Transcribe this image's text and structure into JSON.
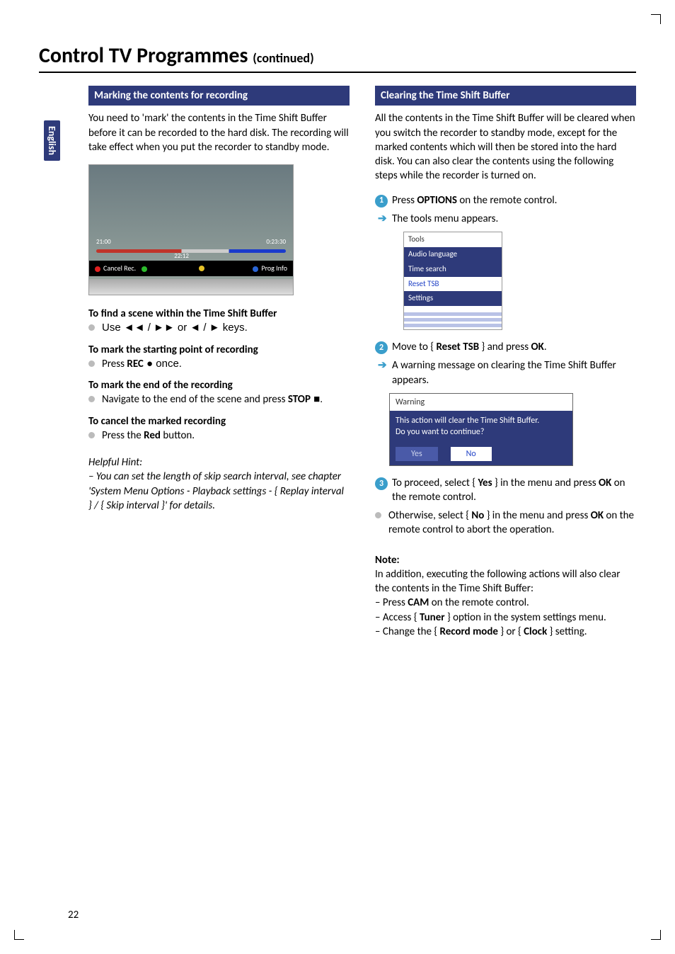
{
  "sideTab": "English",
  "title_main": "Control TV Programmes ",
  "title_cont": "(continued)",
  "left": {
    "header": "Marking the contents for recording",
    "intro": "You need to 'mark' the contents in the Time Shift Buffer before it can be recorded to the hard disk. The recording will take effect when you put the recorder to standby mode.",
    "screenshot": {
      "time_left": "21:00",
      "time_right": "0:23:30",
      "time_center": "22:12",
      "bar_left": "Cancel Rec.",
      "bar_right": "Prog Info"
    },
    "find_head": "To find a scene within the Time Shift Buffer",
    "find_body": "Use ◄◄ / ►► or ◄ / ► keys.",
    "start_head": "To mark the starting point of recording",
    "start_body_pre": "Press ",
    "start_body_btn": "REC",
    "start_body_post": " ● once.",
    "end_head": "To mark the end of the recording",
    "end_body_pre": "Navigate to the end of the scene and press ",
    "end_body_btn": "STOP",
    "end_body_post": " ■.",
    "cancel_head": "To cancel the marked recording",
    "cancel_body_pre": "Press the ",
    "cancel_body_btn": "Red",
    "cancel_body_post": " button.",
    "hint_label": "Helpful Hint:",
    "hint_body": "–  You can set the length of skip search interval, see chapter 'System Menu Options - Playback settings - { Replay interval } / { Skip interval }' for details."
  },
  "right": {
    "header": "Clearing the Time Shift Buffer",
    "intro": "All the contents in the Time Shift Buffer will be cleared when you switch the recorder to standby mode, except for the marked contents which will then be stored into the hard disk. You can also clear the contents using the following steps while the recorder is turned on.",
    "step1_pre": "Press ",
    "step1_btn": "OPTIONS",
    "step1_post": " on the remote control.",
    "step1_arrow": "The tools menu appears.",
    "tools": {
      "title": "Tools",
      "items": [
        "Audio language",
        "Time search",
        "Reset TSB",
        "Settings"
      ]
    },
    "step2_pre": "Move to { ",
    "step2_opt": "Reset TSB",
    "step2_mid": " } and press ",
    "step2_btn": "OK",
    "step2_post": ".",
    "step2_arrow": "A warning message on clearing the Time Shift Buffer appears.",
    "warn": {
      "title": "Warning",
      "line1": "This action will clear the Time Shift Buffer.",
      "line2": "Do you want to continue?",
      "yes": "Yes",
      "no": "No"
    },
    "step3_pre": "To proceed, select { ",
    "step3_opt": "Yes",
    "step3_mid": " } in the menu and press ",
    "step3_btn": "OK",
    "step3_post": " on the remote control.",
    "otherwise_pre": "Otherwise, select { ",
    "otherwise_opt": "No",
    "otherwise_mid": " } in the menu and press ",
    "otherwise_btn": "OK",
    "otherwise_post": " on the remote control to abort the operation.",
    "note_label": "Note:",
    "note_intro": "In addition, executing the following actions will also clear the contents in the Time Shift Buffer:",
    "note1_pre": "–  Press ",
    "note1_btn": "CAM",
    "note1_post": " on the remote control.",
    "note2_pre": "–  Access { ",
    "note2_opt": "Tuner",
    "note2_post": " } option in the system settings menu.",
    "note3_pre": "–  Change the { ",
    "note3_opt1": "Record mode",
    "note3_mid": " } or { ",
    "note3_opt2": "Clock",
    "note3_post": " } setting."
  },
  "pageNumber": "22"
}
